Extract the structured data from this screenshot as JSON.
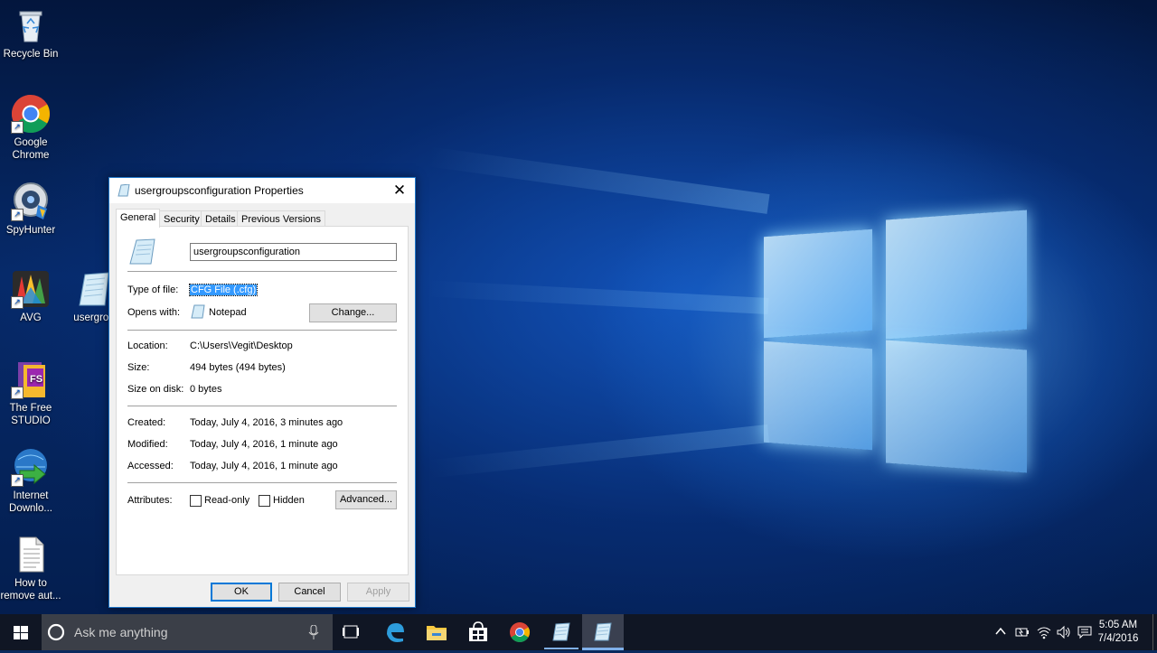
{
  "desktop": {
    "icons": [
      {
        "label": "Recycle Bin"
      },
      {
        "label": "Google Chrome"
      },
      {
        "label": "SpyHunter"
      },
      {
        "label": "AVG"
      },
      {
        "label": "usergrou"
      },
      {
        "label": "The Free STUDIO"
      },
      {
        "label": "Internet Downlo..."
      },
      {
        "label": "How to remove aut..."
      }
    ]
  },
  "dialog": {
    "title": "usergroupsconfiguration Properties",
    "tabs": [
      "General",
      "Security",
      "Details",
      "Previous Versions"
    ],
    "file_name": "usergroupsconfiguration",
    "type_label": "Type of file:",
    "type_value": "CFG File (.cfg)",
    "opens_label": "Opens with:",
    "opens_value": "Notepad",
    "change_button": "Change...",
    "location_label": "Location:",
    "location_value": "C:\\Users\\Vegit\\Desktop",
    "size_label": "Size:",
    "size_value": "494 bytes (494 bytes)",
    "size_disk_label": "Size on disk:",
    "size_disk_value": "0 bytes",
    "created_label": "Created:",
    "created_value": "Today, July 4, 2016, 3 minutes ago",
    "modified_label": "Modified:",
    "modified_value": "Today, July 4, 2016, 1 minute ago",
    "accessed_label": "Accessed:",
    "accessed_value": "Today, July 4, 2016, 1 minute ago",
    "attributes_label": "Attributes:",
    "readonly_label": "Read-only",
    "hidden_label": "Hidden",
    "advanced_button": "Advanced...",
    "ok_button": "OK",
    "cancel_button": "Cancel",
    "apply_button": "Apply"
  },
  "taskbar": {
    "search_placeholder": "Ask me anything",
    "time": "5:05 AM",
    "date": "7/4/2016"
  },
  "colors": {
    "accent": "#0078d7",
    "selection": "#3399ff",
    "taskbar": "#101624"
  }
}
